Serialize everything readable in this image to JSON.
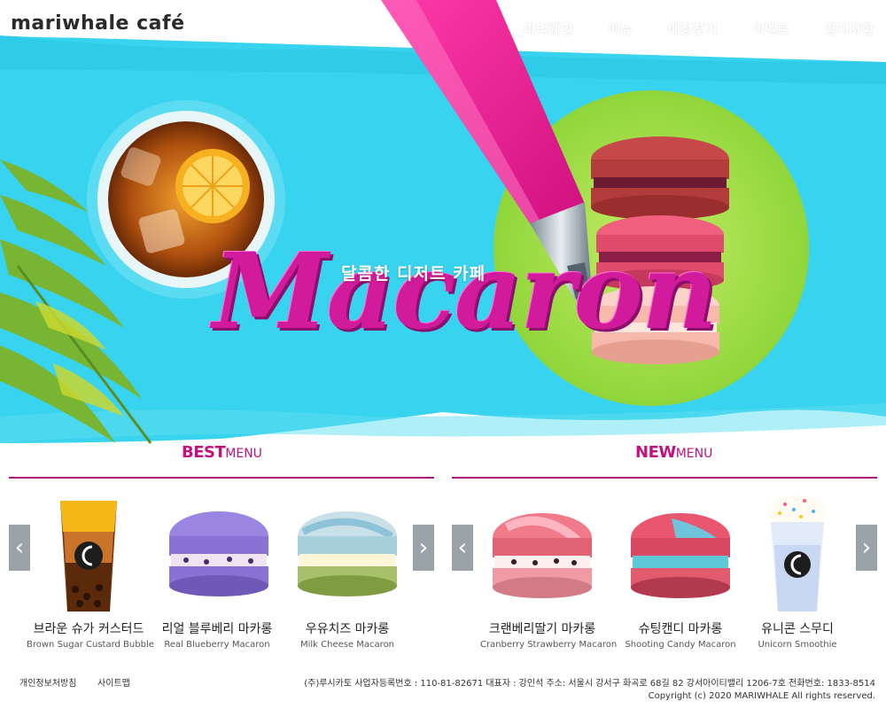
{
  "brand": {
    "logo_text": "mariwhale café"
  },
  "nav": {
    "items": [
      {
        "label": "마리웨일"
      },
      {
        "label": "메뉴"
      },
      {
        "label": "매장찾기"
      },
      {
        "label": "이벤트"
      },
      {
        "label": "공지사항"
      }
    ]
  },
  "hero": {
    "tagline": "달콤한 디저트 카페",
    "title": "Macaron"
  },
  "best": {
    "heading_strong": "BEST",
    "heading_light": "MENU",
    "items": [
      {
        "name_ko": "브라운 슈가 커스터드",
        "name_en": "Brown Sugar Custard Bubble"
      },
      {
        "name_ko": "리얼 블루베리 마카롱",
        "name_en": "Real Blueberry Macaron"
      },
      {
        "name_ko": "우유치즈 마카롱",
        "name_en": "Milk Cheese Macaron"
      }
    ]
  },
  "new": {
    "heading_strong": "NEW",
    "heading_light": "MENU",
    "items": [
      {
        "name_ko": "크랜베리딸기 마카롱",
        "name_en": "Cranberry Strawberry Macaron"
      },
      {
        "name_ko": "슈팅캔디 마카롱",
        "name_en": "Shooting Candy Macaron"
      },
      {
        "name_ko": "유니콘 스무디",
        "name_en": "Unicorn Smoothie"
      }
    ]
  },
  "arrows": {
    "prev": "‹",
    "next": "›"
  },
  "footer": {
    "privacy": "개인정보처방침",
    "sitemap": "사이트맵",
    "company_info": "(주)루시카토 사업자등록번호 : 110-81-82671 대표자 : 강인석 주소: 서울시 강서구 화곡로 68길 82 강서아이티밸리 1206-7호 전화번호: 1833-8514",
    "copyright": "Copyright (c) 2020 MARIWHALE All rights reserved."
  },
  "colors": {
    "accent": "#c3107f",
    "hero_blue": "#33d6f0",
    "arrow_bg": "#9aa3a8"
  }
}
